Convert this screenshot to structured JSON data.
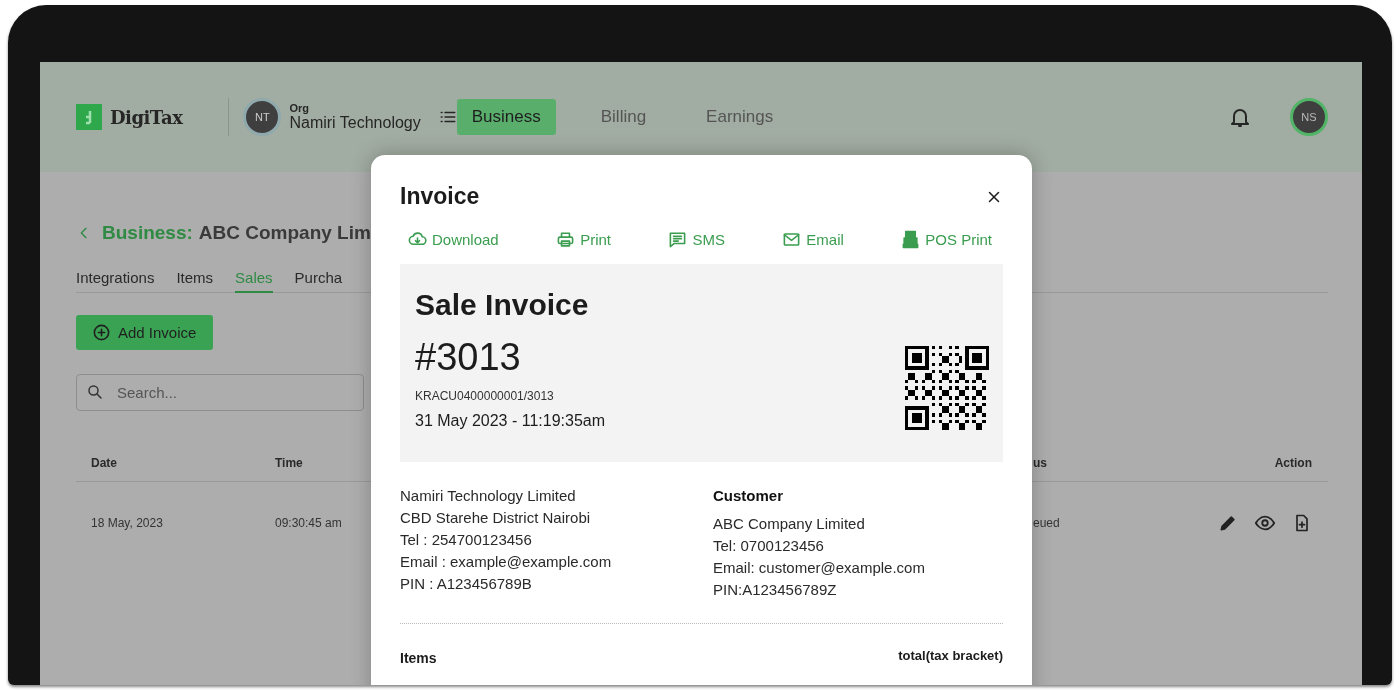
{
  "header": {
    "logo": "DigiTax",
    "org_avatar": "NT",
    "org_label": "Org",
    "org_name": "Namiri Technology",
    "nav": [
      {
        "label": "Business",
        "selected": true
      },
      {
        "label": "Billing",
        "selected": false
      },
      {
        "label": "Earnings",
        "selected": false
      }
    ],
    "user_avatar": "NS"
  },
  "breadcrumb": {
    "section": "Business:",
    "name": "ABC Company Lim"
  },
  "tabs": [
    {
      "label": "Integrations",
      "selected": false
    },
    {
      "label": "Items",
      "selected": false
    },
    {
      "label": "Sales",
      "selected": true
    },
    {
      "label": "Purcha",
      "selected": false
    }
  ],
  "add_button": "Add Invoice",
  "search": {
    "placeholder": "Search..."
  },
  "table": {
    "columns": [
      "Date",
      "Time",
      "us",
      "Action"
    ],
    "rows": [
      {
        "date": "18 May, 2023",
        "time": "09:30:45 am",
        "column_3": "eued"
      }
    ]
  },
  "modal": {
    "title": "Invoice",
    "actions": [
      {
        "kind": "download",
        "label": "Download"
      },
      {
        "kind": "print",
        "label": "Print"
      },
      {
        "kind": "sms",
        "label": "SMS"
      },
      {
        "kind": "email",
        "label": "Email"
      },
      {
        "kind": "pos",
        "label": "POS Print"
      }
    ],
    "invoice": {
      "heading": "Sale Invoice",
      "number": "#3013",
      "code": "KRACU0400000001/3013",
      "datetime": "31 May 2023 - 11:19:35am"
    },
    "seller": [
      "Namiri Technology Limited",
      "CBD Starehe District Nairobi",
      "Tel : 254700123456",
      "Email : example@example.com",
      "PIN : A123456789B"
    ],
    "customer": {
      "heading": "Customer",
      "lines": [
        "ABC Company Limited",
        "Tel: 0700123456",
        "Email: customer@example.com",
        "PIN:A123456789Z"
      ]
    },
    "items_heading": "Items",
    "total_heading": "total(tax bracket)"
  }
}
